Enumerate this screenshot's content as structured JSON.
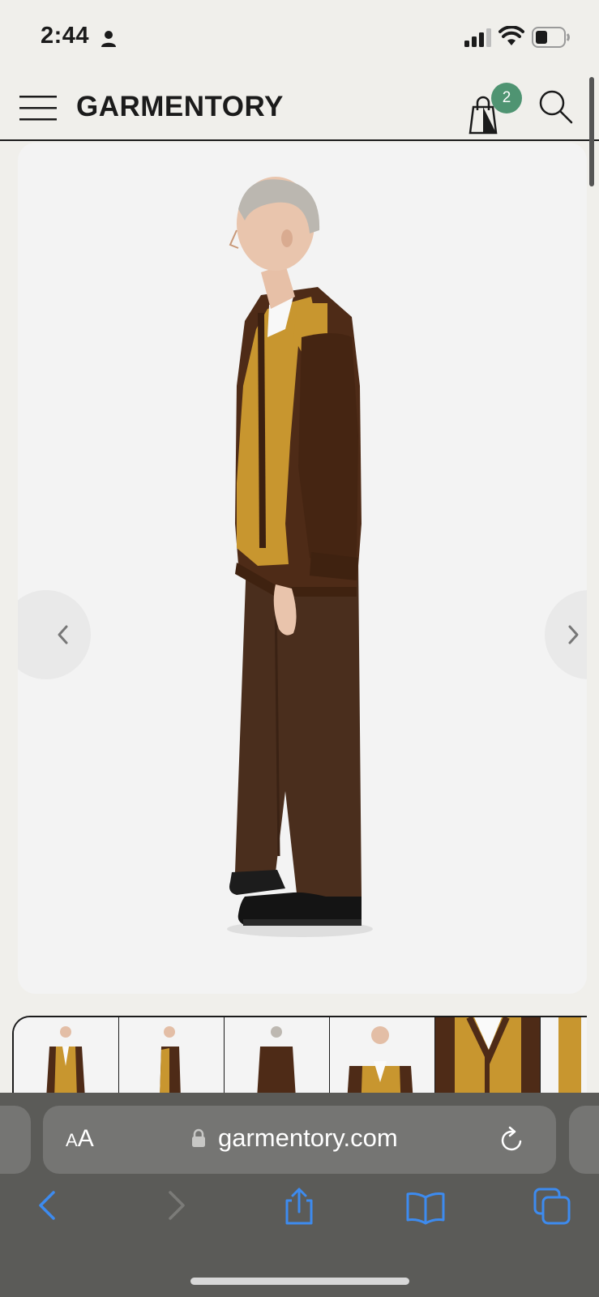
{
  "status_bar": {
    "time": "2:44",
    "icons": [
      "person-icon",
      "cellular-signal-icon",
      "wifi-icon",
      "battery-icon"
    ]
  },
  "header": {
    "logo": "GARMENTORY",
    "cart_count": "2",
    "icons": [
      "hamburger-menu-icon",
      "shopping-bag-icon",
      "search-icon"
    ]
  },
  "gallery": {
    "prev_icon": "chevron-left-icon",
    "next_icon": "chevron-right-icon",
    "thumbnail_count": 6
  },
  "browser": {
    "aa_label_small": "A",
    "aa_label_large": "A",
    "url": "garmentory.com",
    "toolbar_icons": [
      "back-icon",
      "forward-icon",
      "share-icon",
      "bookmarks-icon",
      "tabs-icon",
      "reload-icon",
      "lock-icon"
    ]
  },
  "colors": {
    "page_bg": "#f0efeb",
    "badge": "#4f9472",
    "cardigan_brown": "#4e2b17",
    "cardigan_mustard": "#c8962f",
    "trousers": "#4a2e1d",
    "safari_bar": "#5b5b58",
    "safari_accent": "#3d8bef"
  }
}
